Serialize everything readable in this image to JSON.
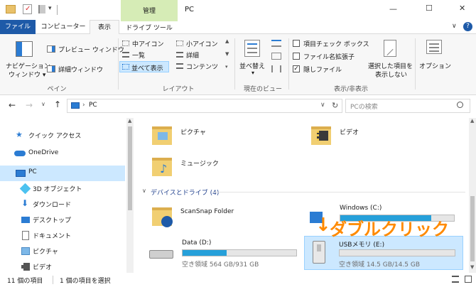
{
  "window": {
    "title": "PC",
    "min_label": "—",
    "max_label": "☐",
    "close_label": "✕"
  },
  "qat": {
    "dropdown": "▾"
  },
  "tabs": {
    "manage": "管理",
    "file": "ファイル",
    "computer": "コンピューター",
    "view": "表示",
    "drive_tools": "ドライブ ツール",
    "help": "?"
  },
  "ribbon": {
    "pane": {
      "nav_pane": "ナビゲーション\nウィンドウ",
      "nav_pane_line1": "ナビゲーション",
      "nav_pane_line2": "ウィンドウ ▾",
      "preview": "プレビュー ウィンドウ",
      "details": "詳細ウィンドウ",
      "group": "ペイン"
    },
    "layout": {
      "medium": "中アイコン",
      "small": "小アイコン",
      "list": "一覧",
      "details": "詳細",
      "tiles": "並べて表示",
      "content": "コンテンツ",
      "group": "レイアウト"
    },
    "current_view": {
      "sort_line1": "並べ替え",
      "group": "現在のビュー"
    },
    "show_hide": {
      "item_checkbox": "項目チェック ボックス",
      "extensions": "ファイル名拡張子",
      "hidden": "隠しファイル",
      "hide_selected_line1": "選択した項目を",
      "hide_selected_line2": "表示しない",
      "group": "表示/非表示",
      "item_checkbox_checked": false,
      "extensions_checked": false,
      "hidden_checked": true
    },
    "options": {
      "label": "オプション"
    }
  },
  "address": {
    "path": "PC",
    "search_placeholder": "PCの検索",
    "dropdown": "∨",
    "refresh": "↻"
  },
  "nav": {
    "items": [
      {
        "label": "クイック アクセス"
      },
      {
        "label": "OneDrive"
      },
      {
        "label": "PC"
      },
      {
        "label": "3D オブジェクト"
      },
      {
        "label": "ダウンロード"
      },
      {
        "label": "デスクトップ"
      },
      {
        "label": "ドキュメント"
      },
      {
        "label": "ピクチャ"
      },
      {
        "label": "ビデオ"
      }
    ]
  },
  "folders": {
    "pictures": "ピクチャ",
    "videos": "ビデオ",
    "music": "ミュージック"
  },
  "devices": {
    "header": "デバイスとドライブ (4)",
    "scansnap": {
      "name": "ScanSnap Folder"
    },
    "windows": {
      "name": "Windows (C:)"
    },
    "data": {
      "name": "Data (D:)",
      "free": "空き領域 564 GB/931 GB",
      "used_fraction": 0.39
    },
    "usb": {
      "name": "USBメモリ (E:)",
      "free": "空き領域 14.5 GB/14.5 GB",
      "used_fraction": 0.0
    },
    "windows_used_fraction": 0.8
  },
  "annotation": {
    "text": "ダブルクリック",
    "arrow": "↓"
  },
  "status": {
    "count": "11 個の項目",
    "selected": "1 個の項目を選択"
  },
  "colors": {
    "accent": "#1e5aa8",
    "manage_tab": "#d6ecb6",
    "selection": "#cce8ff",
    "annotation": "#ff8a00",
    "bar_fill": "#26a0da"
  }
}
